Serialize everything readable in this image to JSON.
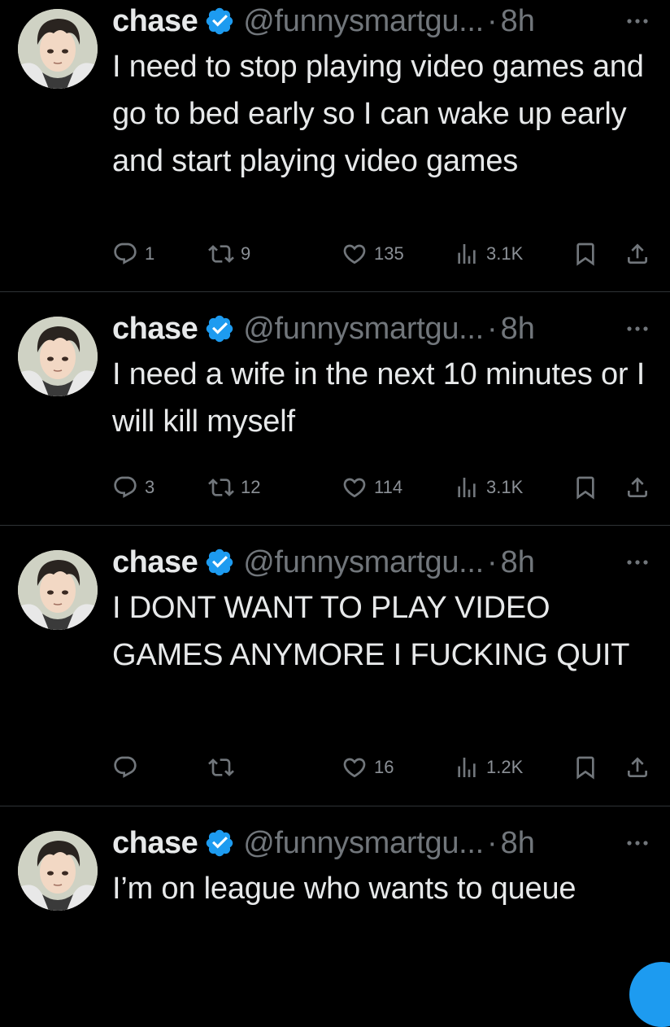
{
  "tweets": [
    {
      "name": "chase",
      "handle": "@funnysmartgu...",
      "separator": "·",
      "time": "8h",
      "text": "I need to stop playing video games and go to bed early so I can wake up early and start playing video games",
      "replies": "1",
      "retweets": "9",
      "likes": "135",
      "views": "3.1K"
    },
    {
      "name": "chase",
      "handle": "@funnysmartgu...",
      "separator": "·",
      "time": "8h",
      "text": "I need a wife in the next 10 minutes or I will kill myself",
      "replies": "3",
      "retweets": "12",
      "likes": "114",
      "views": "3.1K"
    },
    {
      "name": "chase",
      "handle": "@funnysmartgu...",
      "separator": "·",
      "time": "8h",
      "text": "I DONT WANT TO PLAY VIDEO GAMES ANYMORE I FUCKING QUIT",
      "replies": "",
      "retweets": "",
      "likes": "16",
      "views": "1.2K"
    },
    {
      "name": "chase",
      "handle": "@funnysmartgu...",
      "separator": "·",
      "time": "8h",
      "text": "I’m on league who wants to queue",
      "replies": "",
      "retweets": "",
      "likes": "",
      "views": ""
    }
  ],
  "icons": {
    "reply": "reply-icon",
    "retweet": "retweet-icon",
    "like": "heart-icon",
    "views": "views-icon",
    "bookmark": "bookmark-icon",
    "share": "share-icon",
    "verified": "verified-badge-icon",
    "more": "more-icon"
  },
  "colors": {
    "background": "#000000",
    "text": "#e7e9ea",
    "muted": "#71767b",
    "verified": "#1d9bf0",
    "divider": "#2f3336"
  }
}
